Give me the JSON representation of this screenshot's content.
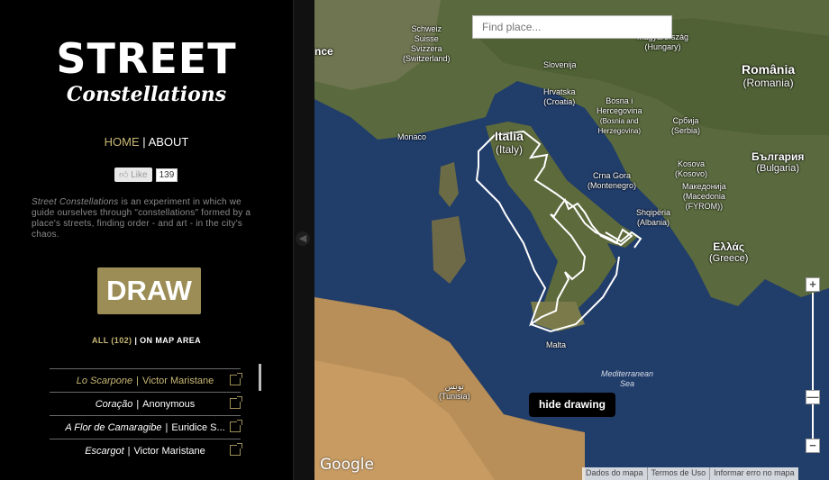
{
  "logo": {
    "line1": "STREET",
    "line2": "Constellations"
  },
  "nav": {
    "home": "HOME",
    "separator": "|",
    "about": "ABOUT"
  },
  "like": {
    "label": "Like",
    "count": "139"
  },
  "description": {
    "title": "Street Constellations",
    "text": " is an experiment in which we guide ourselves through \"constellations\" formed by a place's streets, finding order - and art - in the city's chaos."
  },
  "draw_button": "DRAW",
  "filter": {
    "all": "ALL (102)",
    "separator": "|",
    "on_map": "ON MAP AREA"
  },
  "list": [
    {
      "title": "Lo Scarpone",
      "author": "Victor Maristane"
    },
    {
      "title": "Coração",
      "author": "Anonymous"
    },
    {
      "title": "A Flor de Camaragibe",
      "author": "Euridice S..."
    },
    {
      "title": "Escargot",
      "author": "Victor Maristane"
    }
  ],
  "map": {
    "search_placeholder": "Find place...",
    "labels": {
      "france_partial": "nce",
      "switzerland": [
        "Schweiz",
        "Suisse",
        "Svizzera",
        "(Switzerland)"
      ],
      "hungary": [
        "Magyarország",
        "(Hungary)"
      ],
      "romania": [
        "România",
        "(Romania)"
      ],
      "slovenia": "Slovenija",
      "croatia": [
        "Hrvatska",
        "(Croatia)"
      ],
      "bosnia": [
        "Bosna i",
        "Hercegovina",
        "(Bosnia and",
        "Herzegovina)"
      ],
      "serbia": [
        "Србија",
        "(Serbia)"
      ],
      "monaco": "Monaco",
      "italy": [
        "Italia",
        "(Italy)"
      ],
      "montenegro": [
        "Crna Gora",
        "(Montenegro)"
      ],
      "kosovo": [
        "Kosova",
        "(Kosovo)"
      ],
      "bulgaria": [
        "България",
        "(Bulgaria)"
      ],
      "macedonia": [
        "Македонија",
        "(Macedonia",
        "(FYROM))"
      ],
      "albania": [
        "Shqipëria",
        "(Albania)"
      ],
      "greece": [
        "Ελλάς",
        "(Greece)"
      ],
      "malta": "Malta",
      "tunisia": [
        "تونس",
        "(Tunisia)"
      ],
      "sea": [
        "Mediterranean",
        "Sea"
      ]
    },
    "hide_drawing": "hide drawing",
    "google": "Google",
    "footer": [
      "Dados do mapa",
      "Termos de Uso",
      "Informar erro no mapa"
    ],
    "zoom_plus": "+",
    "zoom_minus": "−"
  }
}
